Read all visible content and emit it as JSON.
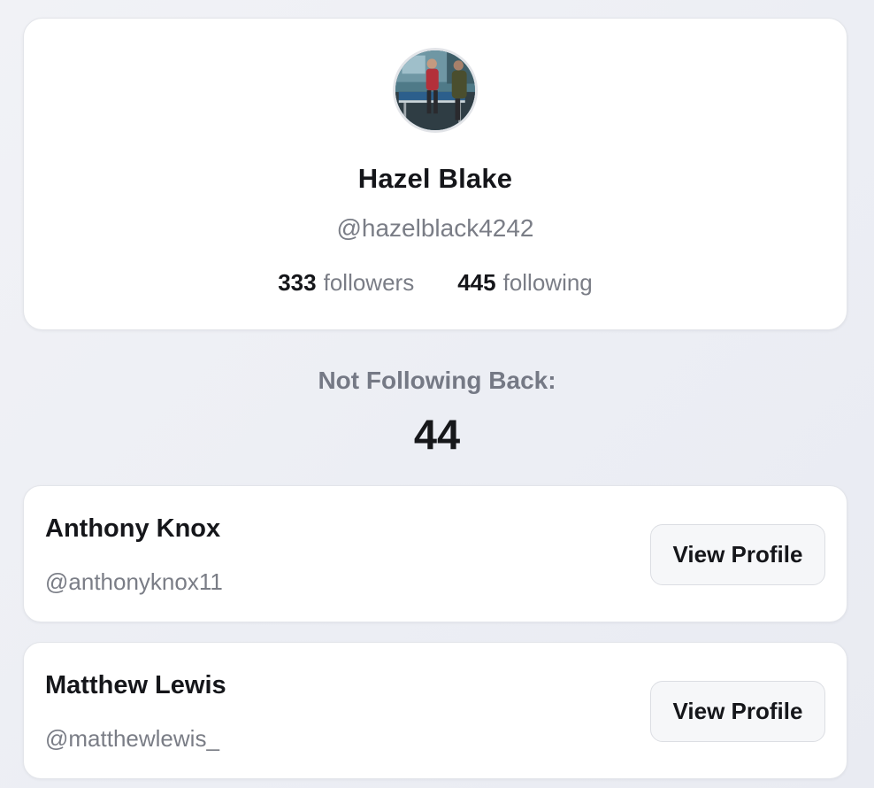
{
  "profile": {
    "name": "Hazel Blake",
    "handle": "@hazelblack4242",
    "followers_count": "333",
    "followers_label": "followers",
    "following_count": "445",
    "following_label": "following",
    "avatar_icon": "avatar-photo"
  },
  "not_following_back": {
    "label": "Not Following Back:",
    "count": "44"
  },
  "users": [
    {
      "name": "Anthony Knox",
      "handle": "@anthonyknox11",
      "button_label": "View Profile"
    },
    {
      "name": "Matthew Lewis",
      "handle": "@matthewlewis_",
      "button_label": "View Profile"
    }
  ]
}
